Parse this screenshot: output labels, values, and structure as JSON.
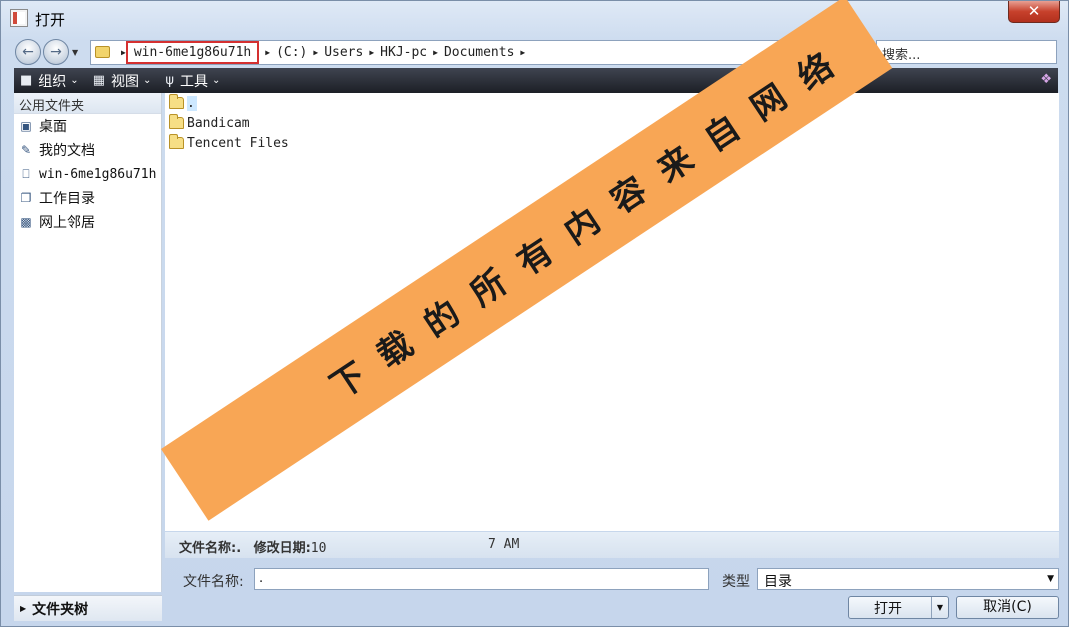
{
  "window": {
    "title": "打开",
    "close_glyph": "✕"
  },
  "address": {
    "crumbs": [
      "win-6me1g86u71h",
      "(C:)",
      "Users",
      "HKJ-pc",
      "Documents"
    ],
    "search_placeholder": "搜索..."
  },
  "toolbar": {
    "organize": "组织",
    "view": "视图",
    "tools": "工具"
  },
  "sidebar": {
    "header": "公用文件夹",
    "items": [
      {
        "label": "桌面",
        "icon": "desktop-icon"
      },
      {
        "label": "我的文档",
        "icon": "documents-icon"
      },
      {
        "label": "win-6me1g86u71h",
        "icon": "computer-icon"
      },
      {
        "label": "工作目录",
        "icon": "workdir-icon"
      },
      {
        "label": "网上邻居",
        "icon": "network-icon"
      }
    ],
    "tree_label": "文件夹树"
  },
  "files": [
    {
      "name": "."
    },
    {
      "name": "Bandicam"
    },
    {
      "name": "Tencent Files"
    }
  ],
  "details": {
    "name_label": "文件名称:",
    "name_value": ".",
    "date_label": "修改日期:",
    "date_value_start": "10",
    "date_value_end": "7 AM"
  },
  "form": {
    "filename_label": "文件名称:",
    "filename_value": ".",
    "type_label": "类型",
    "type_value": "目录",
    "open_label": "打开",
    "cancel_label": "取消(C)"
  },
  "watermark": "下载的所有内容来自网络",
  "colors": {
    "banner": "#f8a655",
    "highlight": "#d43030",
    "toolbar": "#1c1f26"
  }
}
